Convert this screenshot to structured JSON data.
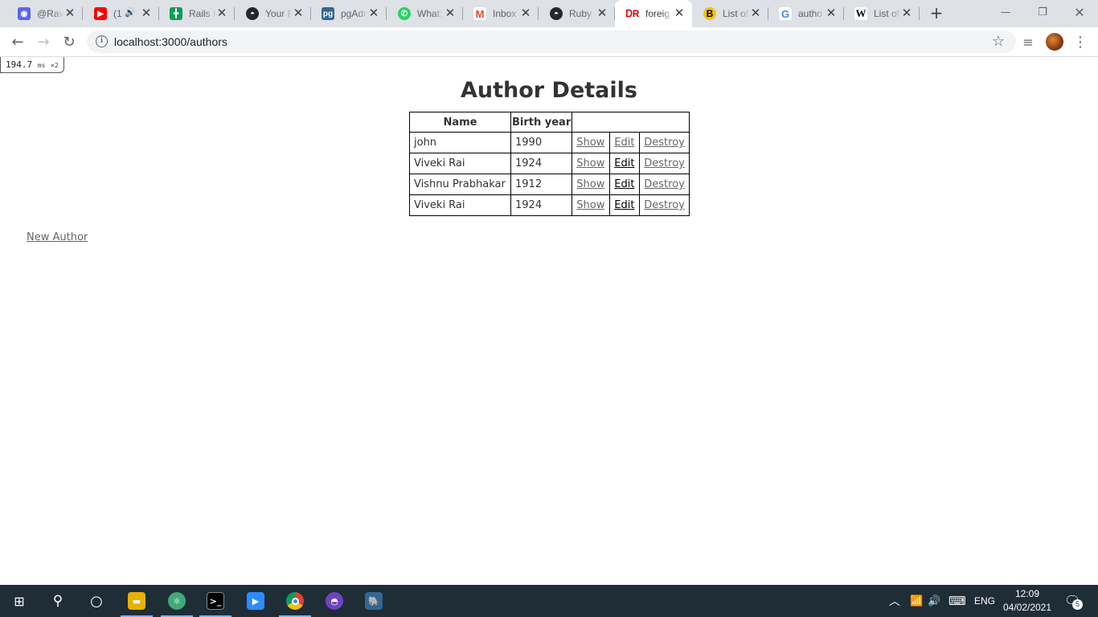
{
  "browser": {
    "tabs": [
      {
        "title": "@Rav",
        "icon": "discord-icon",
        "color": "#5865f2"
      },
      {
        "title": "(1",
        "icon": "youtube-icon",
        "color": "#ff0000"
      },
      {
        "title": "Rails F",
        "icon": "sheets-icon",
        "color": "#0f9d58"
      },
      {
        "title": "Your F",
        "icon": "github-icon",
        "color": "#24292e"
      },
      {
        "title": "pgAdr",
        "icon": "pgadmin-icon",
        "color": "#336791"
      },
      {
        "title": "What:",
        "icon": "whatsapp-icon",
        "color": "#25d366"
      },
      {
        "title": "Inbox",
        "icon": "gmail-icon",
        "color": "#ea4335"
      },
      {
        "title": "Ruby",
        "icon": "github-icon",
        "color": "#24292e"
      },
      {
        "title": "foreig",
        "icon": "rails-icon",
        "color": "#cc0000"
      },
      {
        "title": "List of",
        "icon": "bing-b-icon",
        "color": "#f4c20d"
      },
      {
        "title": "autho",
        "icon": "google-icon",
        "color": "#4285f4"
      },
      {
        "title": "List of",
        "icon": "wikipedia-icon",
        "color": "#000000"
      }
    ],
    "active_tab_index": 8,
    "url": "localhost:3000/authors"
  },
  "perf_badge": {
    "time": "194.7",
    "unit": "ms",
    "count": "×2"
  },
  "page": {
    "title": "Author Details",
    "table": {
      "headers": [
        "Name",
        "Birth year",
        ""
      ],
      "rows": [
        {
          "name": "john",
          "birth_year": "1990",
          "show": "Show",
          "edit": "Edit",
          "destroy": "Destroy"
        },
        {
          "name": "Viveki Rai",
          "birth_year": "1924",
          "show": "Show",
          "edit": "Edit",
          "destroy": "Destroy"
        },
        {
          "name": "Vishnu Prabhakar",
          "birth_year": "1912",
          "show": "Show",
          "edit": "Edit",
          "destroy": "Destroy"
        },
        {
          "name": "Viveki Rai",
          "birth_year": "1924",
          "show": "Show",
          "edit": "Edit",
          "destroy": "Destroy"
        }
      ]
    },
    "new_author_link": "New Author"
  },
  "taskbar": {
    "language": "ENG",
    "time": "12:09",
    "date": "04/02/2021",
    "notification_count": "5"
  },
  "colors": {
    "taskbar": "#1f2d36",
    "link": "#666666",
    "visited_link": "#000000"
  }
}
